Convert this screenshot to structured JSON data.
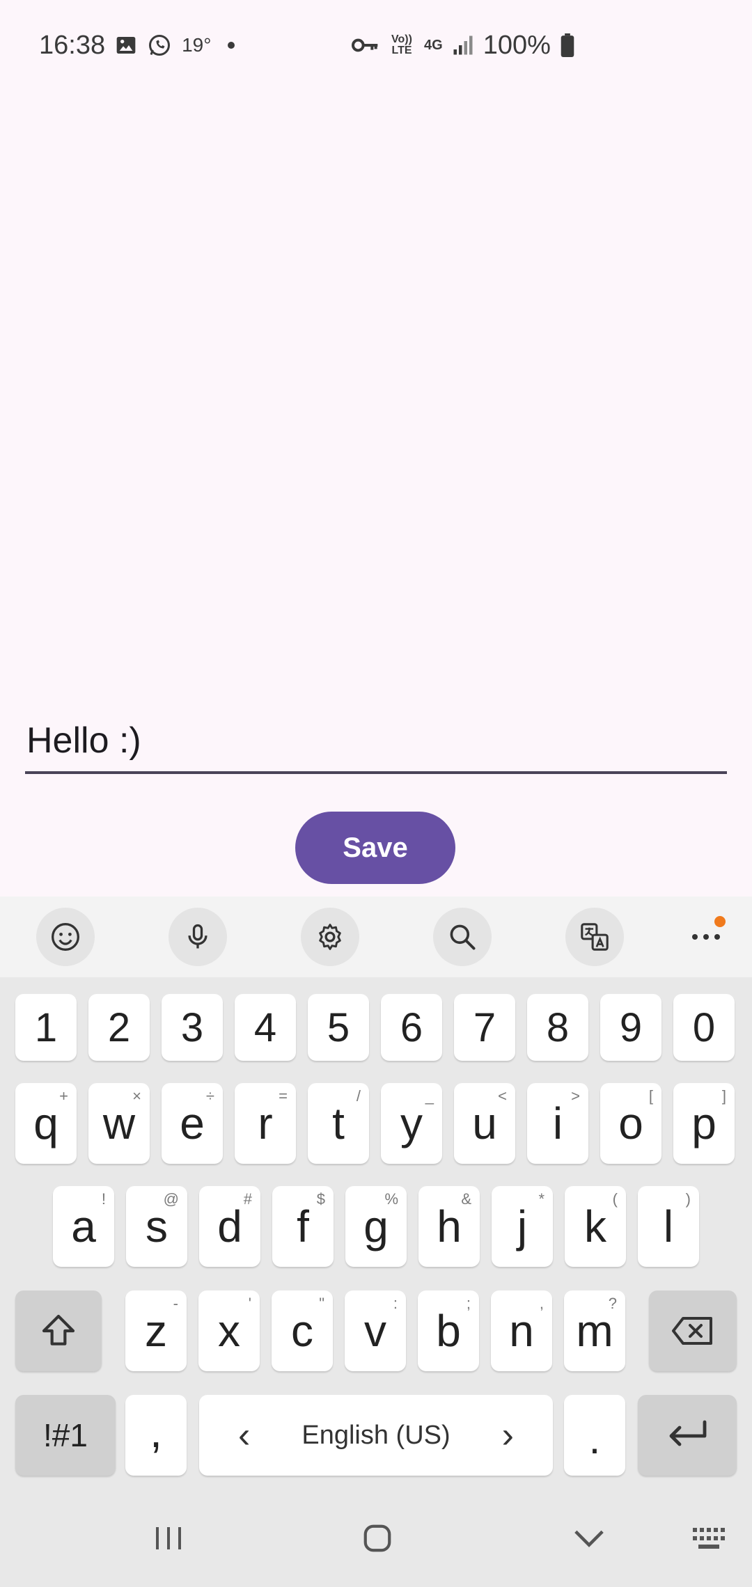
{
  "status_bar": {
    "time": "16:38",
    "temperature": "19°",
    "battery": "100%",
    "left_icons": [
      "gallery-icon",
      "whatsapp-icon"
    ],
    "right_icons": [
      "vpn-key-icon",
      "volte-icon",
      "4g-icon",
      "signal-icon",
      "battery-icon"
    ],
    "volte_label": "Vo)) LTE",
    "network_label": "4G"
  },
  "form": {
    "text_value": "Hello :)",
    "save_label": "Save"
  },
  "colors": {
    "accent": "#6750a4",
    "background": "#fdf6fb",
    "notification_dot": "#f07a1c"
  },
  "keyboard": {
    "toolbar": [
      "emoji-icon",
      "mic-icon",
      "settings-icon",
      "search-icon",
      "translate-icon",
      "more-icon"
    ],
    "number_row": [
      "1",
      "2",
      "3",
      "4",
      "5",
      "6",
      "7",
      "8",
      "9",
      "0"
    ],
    "row1": [
      {
        "key": "q",
        "hint": "+"
      },
      {
        "key": "w",
        "hint": "×"
      },
      {
        "key": "e",
        "hint": "÷"
      },
      {
        "key": "r",
        "hint": "="
      },
      {
        "key": "t",
        "hint": "/"
      },
      {
        "key": "y",
        "hint": "_"
      },
      {
        "key": "u",
        "hint": "<"
      },
      {
        "key": "i",
        "hint": ">"
      },
      {
        "key": "o",
        "hint": "["
      },
      {
        "key": "p",
        "hint": "]"
      }
    ],
    "row2": [
      {
        "key": "a",
        "hint": "!"
      },
      {
        "key": "s",
        "hint": "@"
      },
      {
        "key": "d",
        "hint": "#"
      },
      {
        "key": "f",
        "hint": "$"
      },
      {
        "key": "g",
        "hint": "%"
      },
      {
        "key": "h",
        "hint": "&"
      },
      {
        "key": "j",
        "hint": "*"
      },
      {
        "key": "k",
        "hint": "("
      },
      {
        "key": "l",
        "hint": ")"
      }
    ],
    "row3": [
      {
        "key": "z",
        "hint": "-"
      },
      {
        "key": "x",
        "hint": "'"
      },
      {
        "key": "c",
        "hint": "\""
      },
      {
        "key": "v",
        "hint": ":"
      },
      {
        "key": "b",
        "hint": ";"
      },
      {
        "key": "n",
        "hint": ","
      },
      {
        "key": "m",
        "hint": "?"
      }
    ],
    "symbols_label": "!#1",
    "comma_label": ",",
    "space_label": "English (US)",
    "period_label": ".",
    "left_arrow": "‹",
    "right_arrow": "›"
  },
  "nav_bar": [
    "recents-icon",
    "home-icon",
    "back-chevron-icon",
    "keyboard-switch-icon"
  ]
}
